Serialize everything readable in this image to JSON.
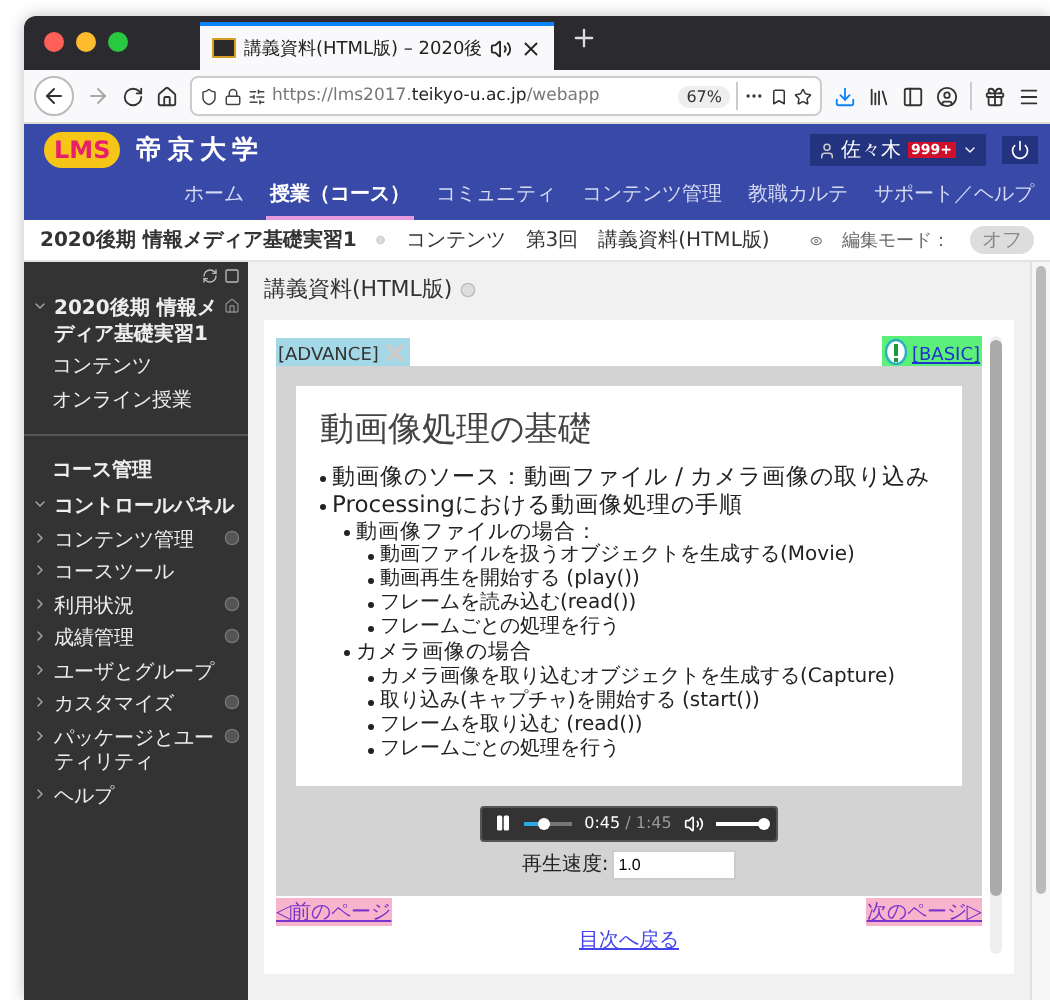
{
  "browser": {
    "tab": {
      "title": "講義資料(HTML版) – 2020後",
      "audio_playing": true
    },
    "url": {
      "scheme": "https://lms2017.",
      "domain": "teikyo-u.ac.jp",
      "path": "/webapp"
    },
    "zoom": "67%"
  },
  "header": {
    "logo": "LMS",
    "university": "帝京大学",
    "user": {
      "name": "佐々木",
      "badge": "999+"
    },
    "nav": [
      {
        "label": "ホーム",
        "selected": false
      },
      {
        "label": "授業（コース）",
        "selected": true
      },
      {
        "label": "コミュニティ",
        "selected": false
      },
      {
        "label": "コンテンツ管理",
        "selected": false
      },
      {
        "label": "教職カルテ",
        "selected": false
      },
      {
        "label": "サポート／ヘルプ",
        "selected": false
      }
    ]
  },
  "breadcrumb": {
    "course": "2020後期 情報メディア基礎実習1",
    "items": [
      "コンテンツ",
      "第3回",
      "講義資料(HTML版)"
    ],
    "edit_mode": {
      "label": "編集モード：",
      "value": "オフ",
      "on": false
    }
  },
  "sidebar": {
    "course": {
      "title": "2020後期 情報メディア基礎実習1",
      "expanded": true,
      "children": [
        "コンテンツ",
        "オンライン授業"
      ]
    },
    "section_title": "コース管理",
    "control_panel": {
      "label": "コントロールパネル",
      "expanded": true,
      "children": [
        {
          "label": "コンテンツ管理",
          "expanded": false,
          "has_options": true
        },
        {
          "label": "コースツール",
          "expanded": false,
          "has_options": false
        },
        {
          "label": "利用状況",
          "expanded": false,
          "has_options": true
        },
        {
          "label": "成績管理",
          "expanded": false,
          "has_options": true
        },
        {
          "label": "ユーザとグループ",
          "expanded": false,
          "has_options": false
        },
        {
          "label": "カスタマイズ",
          "expanded": false,
          "has_options": true
        },
        {
          "label": "パッケージとユーティリティ",
          "expanded": false,
          "has_options": true
        },
        {
          "label": "ヘルプ",
          "expanded": false,
          "has_options": false
        }
      ]
    }
  },
  "content": {
    "title": "講義資料(HTML版)",
    "viewer": {
      "advance": "[ADVANCE]",
      "basic": "[BASIC]",
      "slide": {
        "title": "動画像処理の基礎",
        "bullets": [
          {
            "text": "動画像のソース：動画ファイル / カメラ画像の取り込み"
          },
          {
            "text": "Processingにおける動画像処理の手順",
            "children": [
              {
                "text": "動画像ファイルの場合：",
                "children": [
                  {
                    "text": "動画ファイルを扱うオブジェクトを生成する(Movie)"
                  },
                  {
                    "text": "動画再生を開始する (play())"
                  },
                  {
                    "text": "フレームを読み込む(read())"
                  },
                  {
                    "text": "フレームごとの処理を行う"
                  }
                ]
              },
              {
                "text": "カメラ画像の場合",
                "children": [
                  {
                    "text": "カメラ画像を取り込むオブジェクトを生成する(Capture)"
                  },
                  {
                    "text": "取り込み(キャプチャ)を開始する (start())"
                  },
                  {
                    "text": "フレームを取り込む (read())"
                  },
                  {
                    "text": "フレームごとの処理を行う"
                  }
                ]
              }
            ]
          }
        ]
      },
      "player": {
        "playing": true,
        "level": 0.42,
        "elapsed": "0:45",
        "duration": "/ 1:45",
        "volume": {
          "level": 1
        }
      },
      "speed": {
        "label": "再生速度:",
        "value": "1.0"
      },
      "prev": "◁前のページ",
      "next": "次のページ▷",
      "toc": "目次へ戻る"
    }
  }
}
